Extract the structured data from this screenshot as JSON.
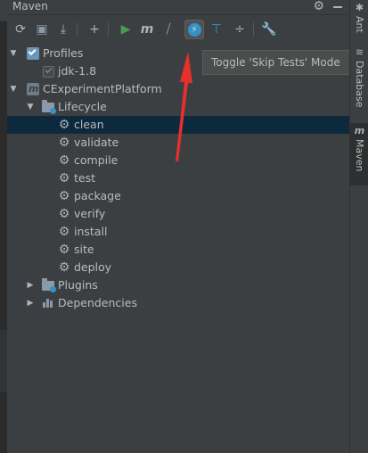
{
  "window": {
    "title": "Maven"
  },
  "header": {
    "gear_icon": "gear-icon",
    "minimize_icon": "minimize-icon"
  },
  "toolbar": {
    "buttons": [
      {
        "name": "reimport-all-button",
        "icon": "refresh-icon",
        "glyph": "⟳",
        "color": "#afb1b3"
      },
      {
        "name": "generate-sources-button",
        "icon": "folder-update-icon",
        "glyph": "▣",
        "color": "#8a9aab"
      },
      {
        "name": "download-sources-button",
        "icon": "download-icon",
        "glyph": "⤓",
        "color": "#afb1b3"
      },
      {
        "name": "add-maven-project-button",
        "icon": "plus-icon",
        "glyph": "+",
        "color": "#afb1b3"
      },
      {
        "name": "run-maven-build-button",
        "icon": "run-icon",
        "glyph": "▶",
        "color": "#499c54"
      },
      {
        "name": "execute-maven-goal-button",
        "icon": "maven-m-icon",
        "glyph": "m",
        "color": "#afb1b3"
      },
      {
        "name": "toggle-offline-mode-button",
        "icon": "offline-icon",
        "glyph": "⧸",
        "color": "#afb1b3"
      },
      {
        "name": "toggle-skip-tests-button",
        "icon": "skip-tests-icon",
        "glyph": "⚡",
        "color": "#3592c4"
      },
      {
        "name": "show-dependencies-button",
        "icon": "diagram-icon",
        "glyph": "⊤",
        "color": "#3592c4"
      },
      {
        "name": "collapse-all-button",
        "icon": "collapse-icon",
        "glyph": "÷",
        "color": "#afb1b3"
      },
      {
        "name": "maven-settings-button",
        "icon": "wrench-icon",
        "glyph": "🔧",
        "color": "#afb1b3"
      }
    ]
  },
  "tooltip": {
    "text": "Toggle 'Skip Tests' Mode"
  },
  "tree": {
    "profiles": "Profiles",
    "profile_jdk": "jdk-1.8",
    "project": "CExperimentPlatform",
    "lifecycle": "Lifecycle",
    "goals": [
      "clean",
      "validate",
      "compile",
      "test",
      "package",
      "verify",
      "install",
      "site",
      "deploy"
    ],
    "plugins": "Plugins",
    "dependencies": "Dependencies"
  },
  "side_tabs": [
    {
      "label": "Ant",
      "icon": "ant-icon",
      "glyph": "✱",
      "active": false
    },
    {
      "label": "Database",
      "icon": "database-icon",
      "glyph": "≋",
      "active": false
    },
    {
      "label": "Maven",
      "icon": "maven-m-icon",
      "glyph": "m",
      "active": true
    }
  ],
  "colors": {
    "selection": "#0d293e",
    "annotation_arrow": "#e8302a",
    "accent_blue": "#3592c4",
    "run_green": "#499c54"
  }
}
